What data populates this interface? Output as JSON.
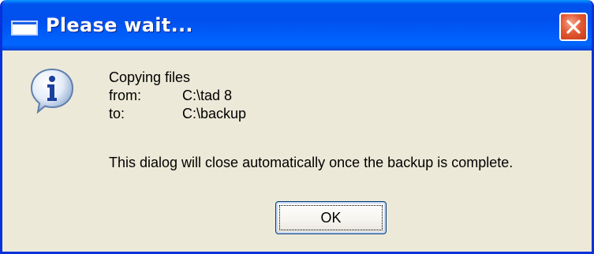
{
  "window": {
    "title": "Please wait...",
    "icon": "window-icon",
    "close_icon": "close-icon"
  },
  "message": {
    "icon": "info-icon",
    "line1": "Copying files",
    "from_label": "from:",
    "from_value": "C:\\tad 8",
    "to_label": "to:",
    "to_value": "C:\\backup",
    "note": "This dialog will close automatically once the backup is complete."
  },
  "buttons": {
    "ok_label": "OK"
  },
  "colors": {
    "titlebar": "#0053ee",
    "dialog_bg": "#ece9d8",
    "close_button": "#e35a33",
    "frame": "#0831d9"
  }
}
